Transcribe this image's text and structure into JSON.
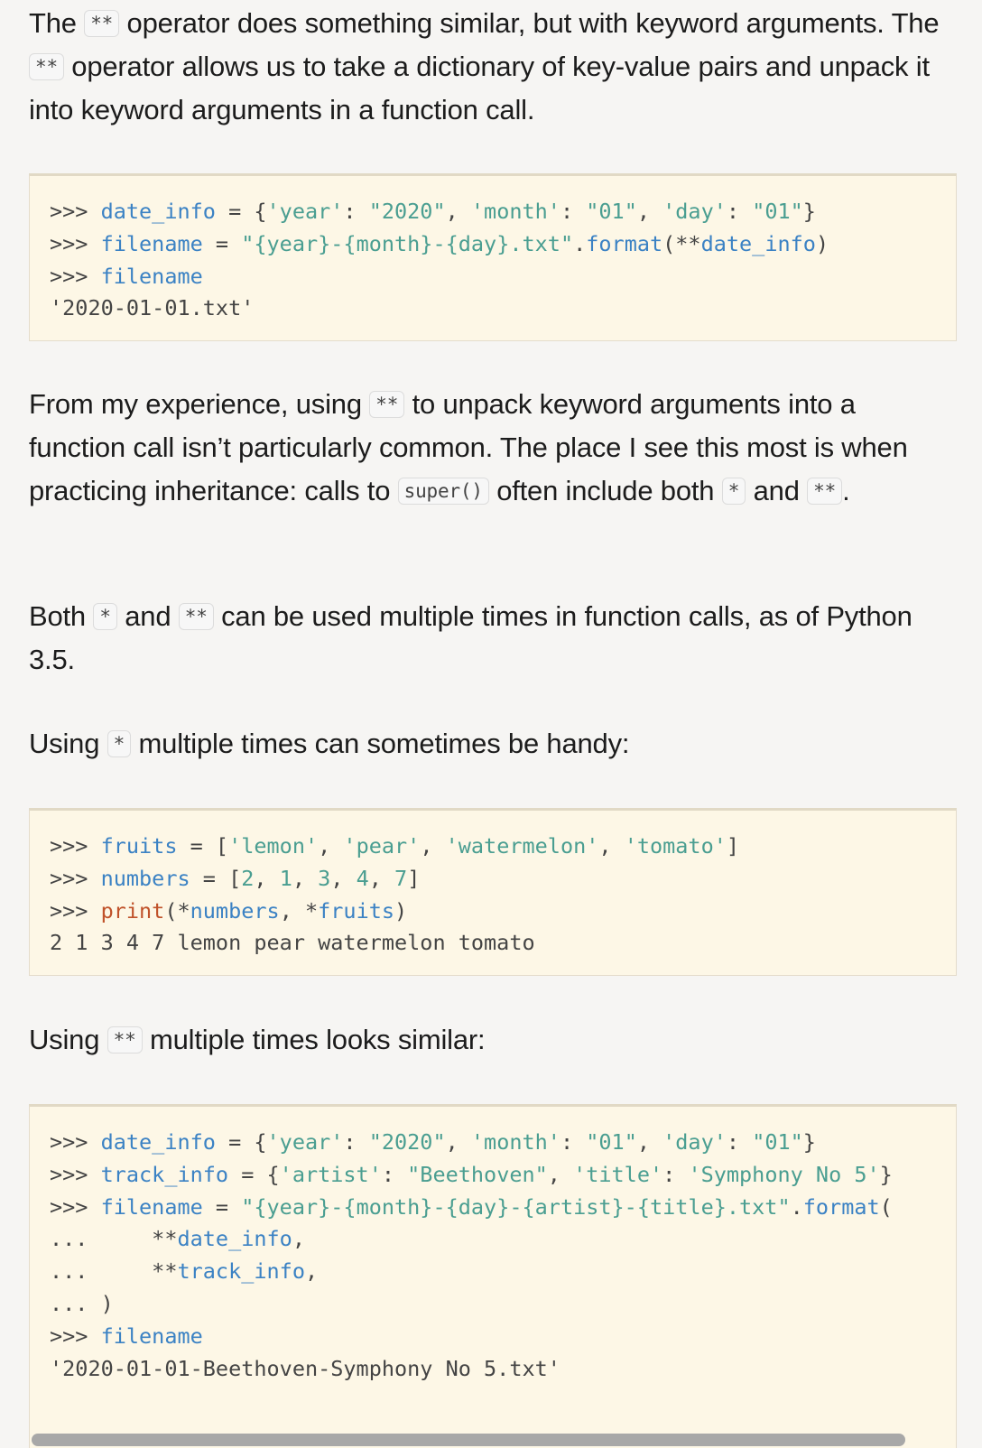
{
  "paragraphs": {
    "p1": {
      "t1": "The ",
      "c1": "**",
      "t2": " operator does something similar, but with keyword arguments. The ",
      "c2": "**",
      "t3": " operator allows us to take a dictionary of key-value pairs and unpack it into keyword arguments in a function call."
    },
    "p2": {
      "t1": "From my experience, using ",
      "c1": "**",
      "t2": " to unpack keyword arguments into a function call isn’t particularly common. The place I see this most is when practicing inheritance: calls to ",
      "c2": "super()",
      "t3": " often include both ",
      "c3": "*",
      "t4": " and ",
      "c4": "**",
      "t5": "."
    },
    "p3": {
      "t1": "Both ",
      "c1": "*",
      "t2": " and ",
      "c2": "**",
      "t3": " can be used multiple times in function calls, as of Python 3.5."
    },
    "p4": {
      "t1": "Using ",
      "c1": "*",
      "t2": " multiple times can sometimes be handy:"
    },
    "p5": {
      "t1": "Using ",
      "c1": "**",
      "t2": " multiple times looks similar:"
    }
  },
  "code_blocks": {
    "block1": {
      "l1": {
        "p": ">>> ",
        "a": "date_info",
        "b": " = {",
        "c": "'year'",
        "d": ": ",
        "e": "\"2020\"",
        "f": ", ",
        "g": "'month'",
        "h": ": ",
        "i": "\"01\"",
        "j": ", ",
        "k": "'day'",
        "l": ": ",
        "m": "\"01\"",
        "n": "}"
      },
      "l2": {
        "p": ">>> ",
        "a": "filename",
        "b": " = ",
        "c": "\"{year}-{month}-{day}.txt\"",
        "d": ".",
        "e": "format",
        "f": "(**",
        "g": "date_info",
        "h": ")"
      },
      "l3": {
        "p": ">>> ",
        "a": "filename"
      },
      "l4": "'2020-01-01.txt'"
    },
    "block2": {
      "l1": {
        "p": ">>> ",
        "a": "fruits",
        "b": " = [",
        "c": "'lemon'",
        "d": ", ",
        "e": "'pear'",
        "f": ", ",
        "g": "'watermelon'",
        "h": ", ",
        "i": "'tomato'",
        "j": "]"
      },
      "l2": {
        "p": ">>> ",
        "a": "numbers",
        "b": " = [",
        "c": "2",
        "d": ", ",
        "e": "1",
        "f": ", ",
        "g": "3",
        "h": ", ",
        "i": "4",
        "j": ", ",
        "k": "7",
        "l": "]"
      },
      "l3": {
        "p": ">>> ",
        "a": "print",
        "b": "(*",
        "c": "numbers",
        "d": ", *",
        "e": "fruits",
        "f": ")"
      },
      "l4": "2 1 3 4 7 lemon pear watermelon tomato"
    },
    "block3": {
      "l1": {
        "p": ">>> ",
        "a": "date_info",
        "b": " = {",
        "c": "'year'",
        "d": ": ",
        "e": "\"2020\"",
        "f": ", ",
        "g": "'month'",
        "h": ": ",
        "i": "\"01\"",
        "j": ", ",
        "k": "'day'",
        "l": ": ",
        "m": "\"01\"",
        "n": "}"
      },
      "l2": {
        "p": ">>> ",
        "a": "track_info",
        "b": " = {",
        "c": "'artist'",
        "d": ": ",
        "e": "\"Beethoven\"",
        "f": ", ",
        "g": "'title'",
        "h": ": ",
        "i": "'Symphony No 5'",
        "j": "}"
      },
      "l3": {
        "p": ">>> ",
        "a": "filename",
        "b": " = ",
        "c": "\"{year}-{month}-{day}-{artist}-{title}.txt\"",
        "d": ".",
        "e": "format",
        "f": "("
      },
      "l4": {
        "p": "...     **",
        "a": "date_info",
        "b": ","
      },
      "l5": {
        "p": "...     **",
        "a": "track_info",
        "b": ","
      },
      "l6": "... )",
      "l7": {
        "p": ">>> ",
        "a": "filename"
      },
      "l8": "'2020-01-01-Beethoven-Symphony No 5.txt'"
    }
  }
}
